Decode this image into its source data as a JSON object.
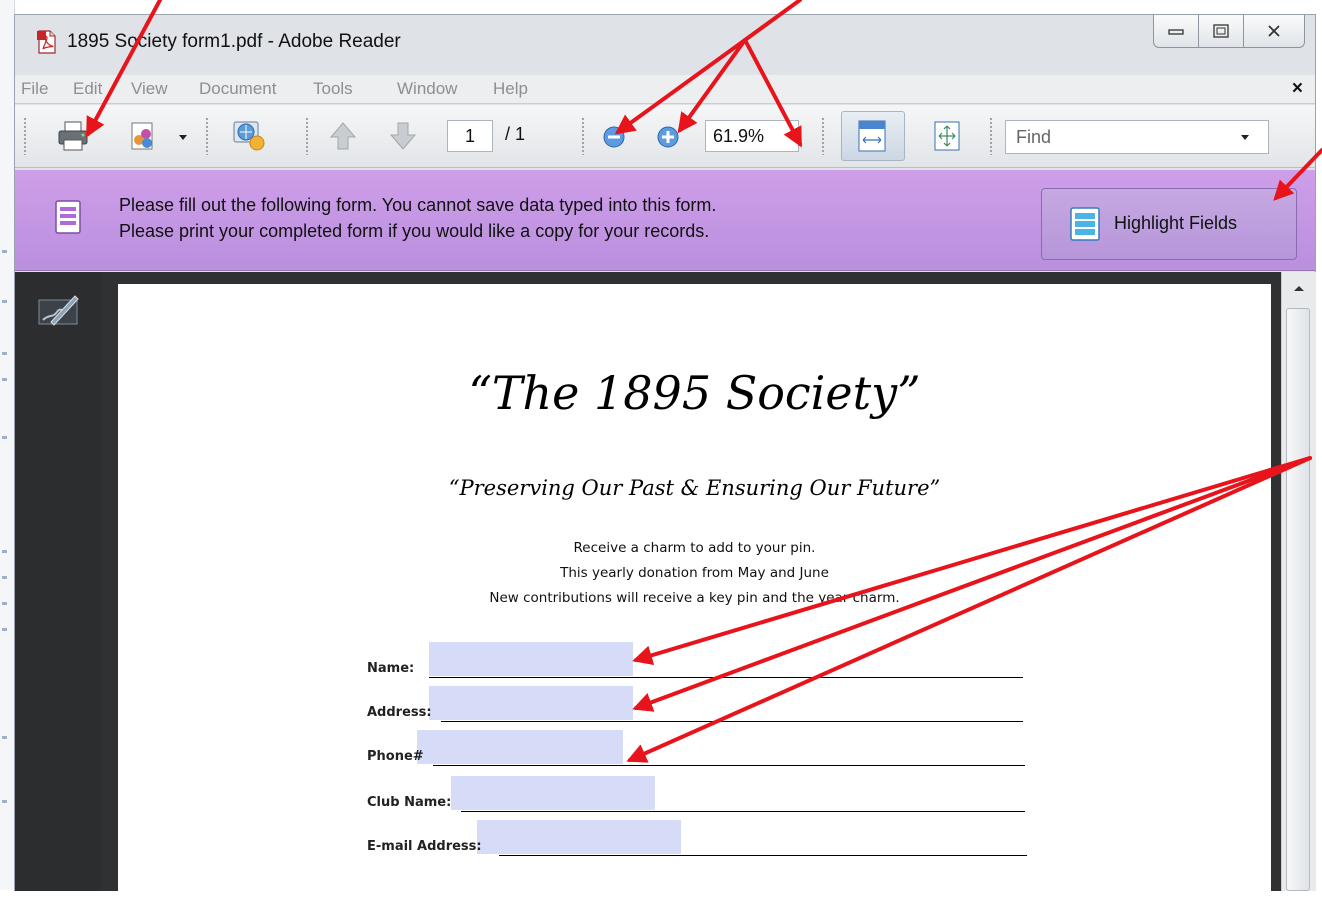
{
  "window": {
    "title": "1895 Society form1.pdf - Adobe Reader",
    "controls": [
      "minimize",
      "maximize",
      "close"
    ]
  },
  "menu": {
    "items": [
      {
        "label": "File"
      },
      {
        "label": "Edit"
      },
      {
        "label": "View"
      },
      {
        "label": "Document"
      },
      {
        "label": "Tools"
      },
      {
        "label": "Window"
      },
      {
        "label": "Help"
      }
    ],
    "close_label": "×"
  },
  "toolbar": {
    "page_number": "1",
    "page_total": "/ 1",
    "zoom": "61.9%",
    "find_placeholder": "Find",
    "icons": [
      "print-icon",
      "share-icon",
      "collaborate-icon",
      "previous-page-icon",
      "next-page-icon",
      "zoom-out-icon",
      "zoom-in-icon",
      "fit-width-icon",
      "fit-page-icon"
    ]
  },
  "form_bar": {
    "message_line1": "Please fill out the following form. You cannot save data typed into this form.",
    "message_line2": "Please print your completed form if you would like a copy for your records.",
    "highlight_button": "Highlight Fields"
  },
  "document": {
    "title": "“The 1895 Society”",
    "motto": "“Preserving Our Past & Ensuring Our Future”",
    "lines": [
      "Receive a charm to add to your pin.",
      "This yearly donation from May and June",
      "New contributions will receive a key pin and the year charm."
    ],
    "fields": [
      {
        "label": "Name:"
      },
      {
        "label": "Address:"
      },
      {
        "label": "Phone#"
      },
      {
        "label": "Club Name:"
      },
      {
        "label": "E-mail Address:"
      }
    ]
  },
  "colors": {
    "annotation_arrow": "#e8141c",
    "form_bar": "#c99ae6",
    "field_highlight": "#d6dcf8"
  }
}
